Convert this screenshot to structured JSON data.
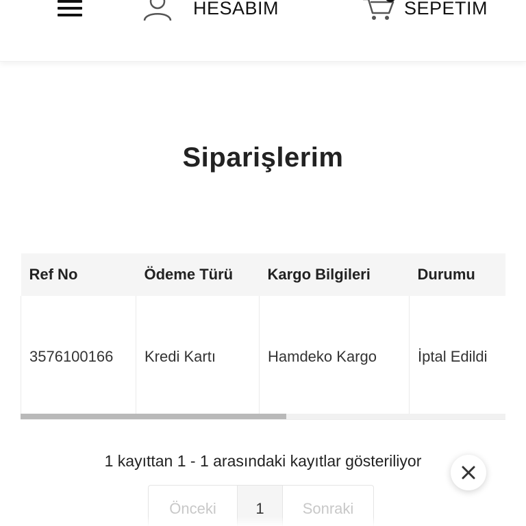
{
  "header": {
    "menu_icon": "hamburger-menu-icon",
    "account_icon": "user-icon",
    "account_label": "HESABIM",
    "cart_icon": "shopping-cart-icon",
    "cart_label": "SEPETİM"
  },
  "page": {
    "title": "Siparişlerim"
  },
  "orders_table": {
    "columns": [
      "Ref No",
      "Ödeme Türü",
      "Kargo Bilgileri",
      "Durumu"
    ],
    "rows": [
      [
        "3576100166",
        "Kredi Kartı",
        "Hamdeko Kargo",
        "İptal Edildi"
      ]
    ]
  },
  "table_info": "1 kayıttan 1 - 1 arasındaki kayıtlar gösteriliyor",
  "pagination": {
    "prev_label": "Önceki",
    "current_page": "1",
    "next_label": "Sonraki"
  },
  "close_icon": "close-icon"
}
